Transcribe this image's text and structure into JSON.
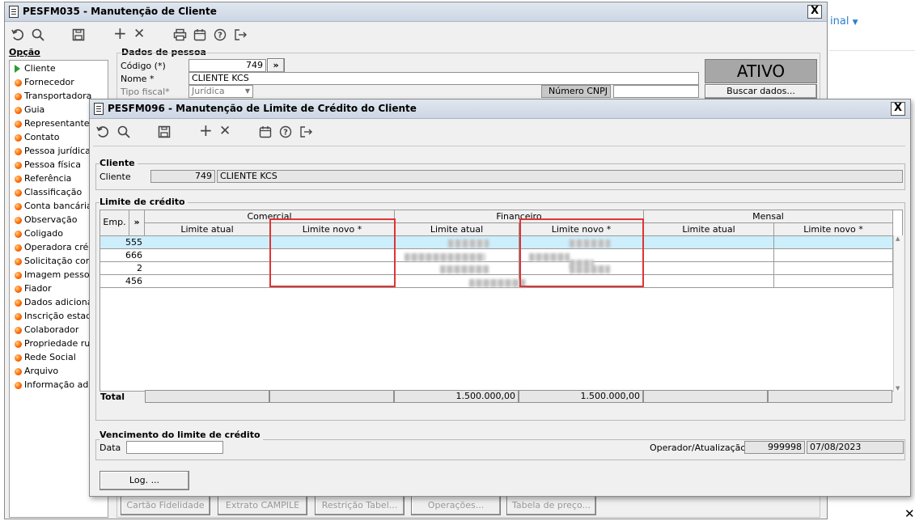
{
  "background_app": {
    "link_text": "inal",
    "link_color": "#2a7fd4"
  },
  "outer_window": {
    "title": "PESFM035 - Manutenção de Cliente",
    "close_label": "X",
    "option_header": "Opção",
    "menu_items": [
      "Cliente",
      "Fornecedor",
      "Transportadora",
      "Guia",
      "Representante",
      "Contato",
      "Pessoa jurídica",
      "Pessoa física",
      "Referência",
      "Classificação",
      "Conta bancária",
      "Observação",
      "Coligado",
      "Operadora crédito",
      "Solicitação consulta",
      "Imagem pessoa",
      "Fiador",
      "Dados adicionais",
      "Inscrição estadual",
      "Colaborador",
      "Propriedade rural",
      "Rede Social",
      "Arquivo",
      "Informação adicional"
    ],
    "pessoa": {
      "section_title": "Dados de pessoa",
      "codigo_label": "Código (*)",
      "codigo_value": "749",
      "more_button": "»",
      "nome_label": "Nome *",
      "nome_value": "CLIENTE  KCS",
      "tipo_fiscal_label": "Tipo fiscal*",
      "tipo_fiscal_value": "Jurídica",
      "cnpj_label": "Número CNPJ",
      "status": "ATIVO",
      "buscar_button": "Buscar dados..."
    },
    "bottom_buttons": [
      "Cartão Fidelidade",
      "Extrato CAMPILE",
      "Restrição Tabel...",
      "Operações...",
      "Tabela de preço..."
    ]
  },
  "credit_window": {
    "title": "PESFM096 - Manutenção de Limite de Crédito do Cliente",
    "close_label": "X",
    "cliente": {
      "section_title": "Cliente",
      "label": "Cliente",
      "code": "749",
      "name": "CLIENTE  KCS"
    },
    "limite": {
      "section_title": "Limite de crédito",
      "emp_header": "Emp.",
      "expand_header": "»",
      "groups": [
        "Comercial",
        "Financeiro",
        "Mensal"
      ],
      "sub_headers": [
        "Limite atual",
        "Limite novo *",
        "Limite atual",
        "Limite novo *",
        "Limite atual",
        "Limite novo *"
      ],
      "rows": [
        {
          "emp": "555"
        },
        {
          "emp": "666"
        },
        {
          "emp": "2"
        },
        {
          "emp": "456"
        }
      ],
      "total_label": "Total",
      "totals": [
        "",
        "",
        "1.500.000,00",
        "1.500.000,00",
        "",
        ""
      ]
    },
    "vencimento": {
      "section_title": "Vencimento do limite de crédito",
      "data_label": "Data",
      "data_value": "",
      "operador_label": "Operador/Atualização",
      "operador_value": "999998",
      "atualizacao_value": "07/08/2023"
    },
    "log_button": "Log. ...",
    "highlight_color": "#e03434",
    "selected_row_color": "#cdeefb"
  }
}
